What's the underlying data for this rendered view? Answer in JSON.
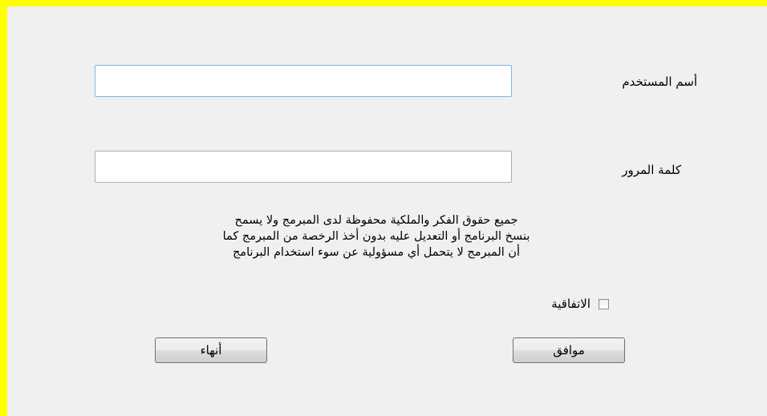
{
  "form": {
    "username_label": "أسم المستخدم",
    "username_value": "",
    "password_label": "كلمة المرور",
    "password_value": "",
    "notice_lines": [
      "جميع حقوق الفكر والملكية محفوظة لدى المبرمج ولا يسمح",
      "بنسخ البرنامج أو التعديل عليه بدون أخذ الرخصة من المبرمج كما",
      "أن المبرمج لا يتحمل أي مسؤولية عن سوء استخدام البرنامج"
    ],
    "agree_label": "الاتفاقية",
    "agree_checked": false,
    "ok_label": "موافق",
    "exit_label": "أنهاء"
  },
  "colors": {
    "frame_border": "#ffff00",
    "window_background": "#f0f0f0",
    "focused_input_border": "#7eb4ea"
  }
}
